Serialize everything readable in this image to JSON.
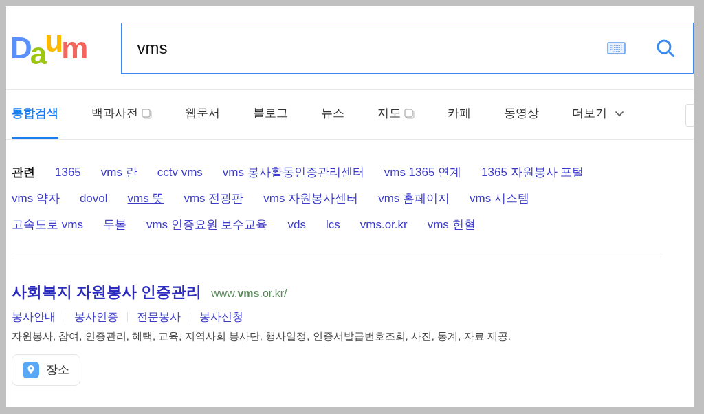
{
  "logo": "Daum",
  "search": {
    "value": "vms"
  },
  "tabs": [
    {
      "label": "통합검색",
      "selected": true,
      "kind": "plain"
    },
    {
      "label": "백과사전",
      "selected": false,
      "kind": "external"
    },
    {
      "label": "웹문서",
      "selected": false,
      "kind": "plain"
    },
    {
      "label": "블로그",
      "selected": false,
      "kind": "plain"
    },
    {
      "label": "뉴스",
      "selected": false,
      "kind": "plain"
    },
    {
      "label": "지도",
      "selected": false,
      "kind": "external"
    },
    {
      "label": "카페",
      "selected": false,
      "kind": "plain"
    },
    {
      "label": "동영상",
      "selected": false,
      "kind": "plain"
    },
    {
      "label": "더보기",
      "selected": false,
      "kind": "more"
    }
  ],
  "related": {
    "label": "관련",
    "rows": [
      [
        {
          "text": "1365",
          "underlined": false
        },
        {
          "text": "vms 란",
          "underlined": false
        },
        {
          "text": "cctv vms",
          "underlined": false
        },
        {
          "text": "vms 봉사활동인증관리센터",
          "underlined": false
        },
        {
          "text": "vms 1365 연계",
          "underlined": false
        },
        {
          "text": "1365 자원봉사 포털",
          "underlined": false
        }
      ],
      [
        {
          "text": "vms 약자",
          "underlined": false
        },
        {
          "text": "dovol",
          "underlined": false
        },
        {
          "text": "vms 뜻",
          "underlined": true
        },
        {
          "text": "vms 전광판",
          "underlined": false
        },
        {
          "text": "vms 자원봉사센터",
          "underlined": false
        },
        {
          "text": "vms 홈페이지",
          "underlined": false
        },
        {
          "text": "vms 시스템",
          "underlined": false
        }
      ],
      [
        {
          "text": "고속도로 vms",
          "underlined": false
        },
        {
          "text": "두볼",
          "underlined": false
        },
        {
          "text": "vms 인증요원 보수교육",
          "underlined": false
        },
        {
          "text": "vds",
          "underlined": false
        },
        {
          "text": "lcs",
          "underlined": false
        },
        {
          "text": "vms.or.kr",
          "underlined": false
        },
        {
          "text": "vms 헌혈",
          "underlined": false
        }
      ]
    ]
  },
  "result": {
    "title": "사회복지 자원봉사 인증관리",
    "url": "www.**vms**.or.kr/",
    "sublinks": [
      "봉사안내",
      "봉사인증",
      "전문봉사",
      "봉사신청"
    ],
    "description": "자원봉사, 참여, 인증관리, 혜택, 교육, 지역사회 봉사단, 행사일정, 인증서발급번호조회, 사진, 통계, 자료 제공.",
    "place_button": "장소"
  }
}
